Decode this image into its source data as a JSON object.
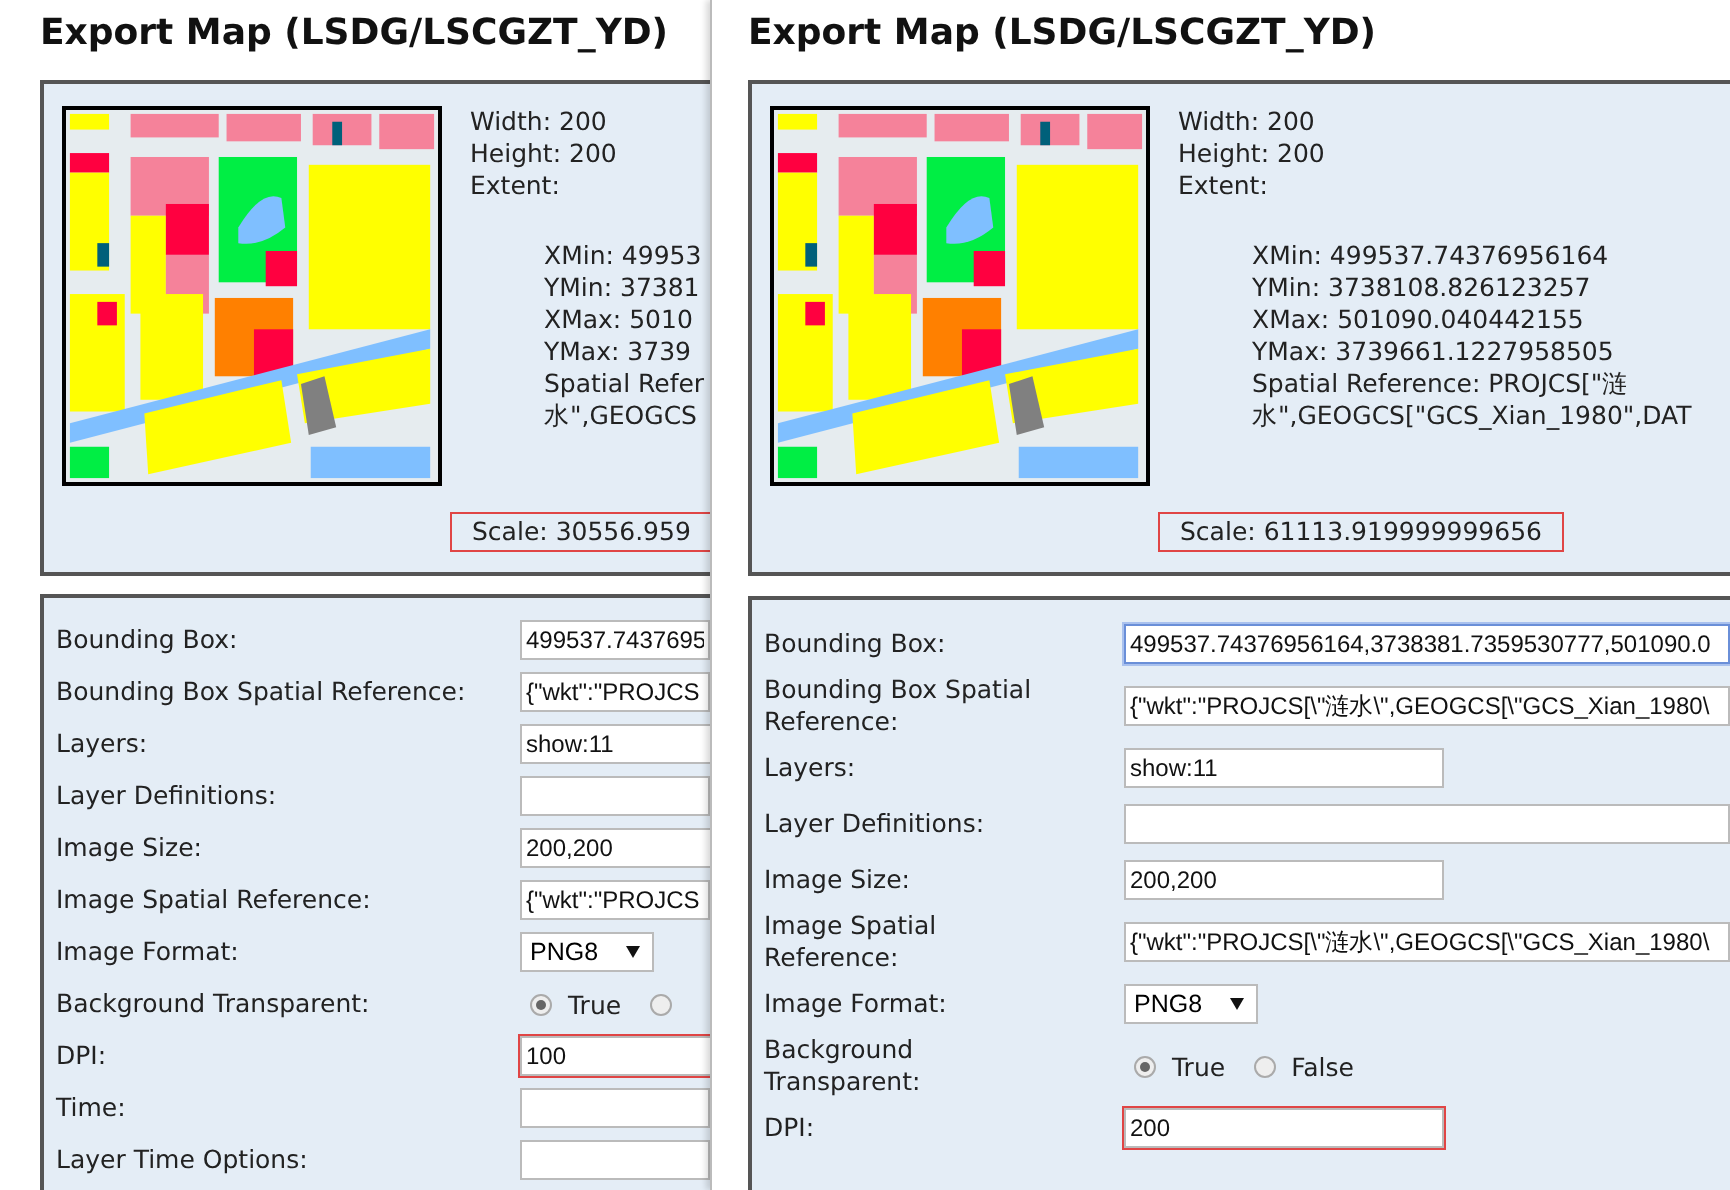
{
  "panels": [
    {
      "title": "Export Map (LSDG/LSCGZT_YD)",
      "info": [
        "Width: 200",
        "Height: 200",
        "Extent:"
      ],
      "extent": [
        "XMin: 49953",
        "YMin: 37381",
        "XMax: 5010",
        "YMax: 3739",
        "Spatial Refer",
        "水\",GEOGCS"
      ],
      "scale": {
        "text": "Scale: 30556.959",
        "highlighted": true
      },
      "rows": [
        {
          "label": "Bounding Box:",
          "kind": "text",
          "value": "499537.7437695",
          "focused": false,
          "highlighted": false
        },
        {
          "label": "Bounding Box Spatial Reference:",
          "kind": "text",
          "value": "{\"wkt\":\"PROJCS",
          "focused": false,
          "highlighted": false
        },
        {
          "label": "Layers:",
          "kind": "short",
          "value": "show:11",
          "focused": false,
          "highlighted": false
        },
        {
          "label": "Layer Definitions:",
          "kind": "text",
          "focused": false,
          "highlighted": false
        },
        {
          "label": "Image Size:",
          "kind": "short",
          "value": "200,200",
          "focused": false,
          "highlighted": false
        },
        {
          "label": "Image Spatial Reference:",
          "kind": "text",
          "value": "{\"wkt\":\"PROJCS",
          "focused": false,
          "highlighted": false
        },
        {
          "label": "Image Format:",
          "kind": "select",
          "value": "PNG8"
        },
        {
          "label": "Background Transparent:",
          "kind": "radio",
          "options": [
            {
              "label": "True",
              "selected": true
            },
            {
              "selected": false
            }
          ]
        },
        {
          "label": "DPI:",
          "kind": "short",
          "value": "100",
          "focused": false,
          "highlighted": true
        },
        {
          "label": "Time:",
          "kind": "text",
          "focused": false,
          "highlighted": false
        },
        {
          "label": "Layer Time Options:",
          "kind": "text",
          "focused": false,
          "highlighted": false
        }
      ]
    },
    {
      "title": "Export Map (LSDG/LSCGZT_YD)",
      "info": [
        "Width: 200",
        "Height: 200",
        "Extent:"
      ],
      "extent": [
        "XMin: 499537.74376956164",
        "YMin: 3738108.826123257",
        "XMax: 501090.040442155",
        "YMax: 3739661.1227958505",
        "Spatial Reference: PROJCS[\"涟",
        "水\",GEOGCS[\"GCS_Xian_1980\",DAT"
      ],
      "scale": {
        "text": "Scale: 61113.919999999656",
        "highlighted": true
      },
      "rows": [
        {
          "label": "Bounding Box:",
          "kind": "text",
          "value": "499537.74376956164,3738381.7359530777,501090.0",
          "focused": true,
          "highlighted": false
        },
        {
          "label": "Bounding Box Spatial Reference:",
          "kind": "text",
          "value": "{\"wkt\":\"PROJCS[\\\"涟水\\\",GEOGCS[\\\"GCS_Xian_1980\\",
          "focused": false,
          "highlighted": false
        },
        {
          "label": "Layers:",
          "kind": "short",
          "value": "show:11",
          "focused": false,
          "highlighted": false
        },
        {
          "label": "Layer Definitions:",
          "kind": "text",
          "focused": false,
          "highlighted": false
        },
        {
          "label": "Image Size:",
          "kind": "short",
          "value": "200,200",
          "focused": false,
          "highlighted": false
        },
        {
          "label": "Image Spatial Reference:",
          "kind": "text",
          "value": "{\"wkt\":\"PROJCS[\\\"涟水\\\",GEOGCS[\\\"GCS_Xian_1980\\",
          "focused": false,
          "highlighted": false
        },
        {
          "label": "Image Format:",
          "kind": "select",
          "value": "PNG8"
        },
        {
          "label": "Background Transparent:",
          "kind": "radio",
          "options": [
            {
              "label": "True",
              "selected": true
            },
            {
              "label": "False",
              "selected": false
            }
          ]
        },
        {
          "label": "DPI:",
          "kind": "short",
          "value": "200",
          "focused": false,
          "highlighted": true
        }
      ]
    }
  ]
}
